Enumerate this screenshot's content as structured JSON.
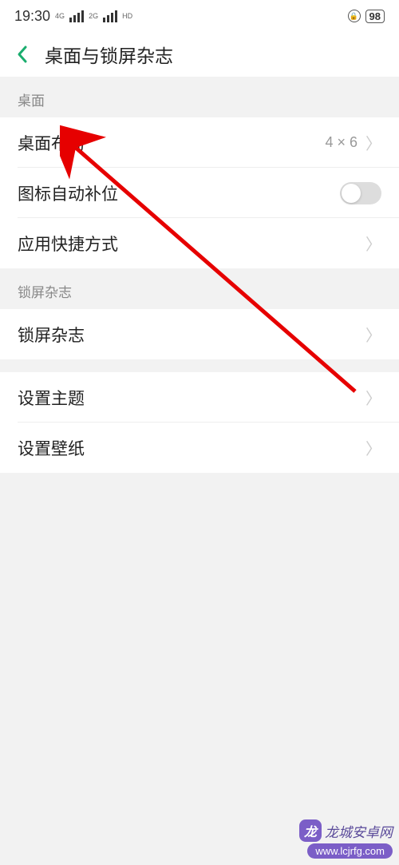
{
  "statusBar": {
    "time": "19:30",
    "signalLabel1": "4G",
    "signalLabel2": "2G",
    "hdLabel": "HD",
    "battery": "98"
  },
  "header": {
    "title": "桌面与锁屏杂志"
  },
  "sections": {
    "desktop": {
      "label": "桌面",
      "items": {
        "layout": {
          "label": "桌面布局",
          "value": "4 × 6"
        },
        "autofill": {
          "label": "图标自动补位"
        },
        "shortcut": {
          "label": "应用快捷方式"
        }
      }
    },
    "lockscreen": {
      "label": "锁屏杂志",
      "items": {
        "magazine": {
          "label": "锁屏杂志"
        }
      }
    },
    "appearance": {
      "items": {
        "theme": {
          "label": "设置主题"
        },
        "wallpaper": {
          "label": "设置壁纸"
        }
      }
    }
  },
  "watermark": {
    "brand": "龙城安卓网",
    "url": "www.lcjrfg.com"
  }
}
